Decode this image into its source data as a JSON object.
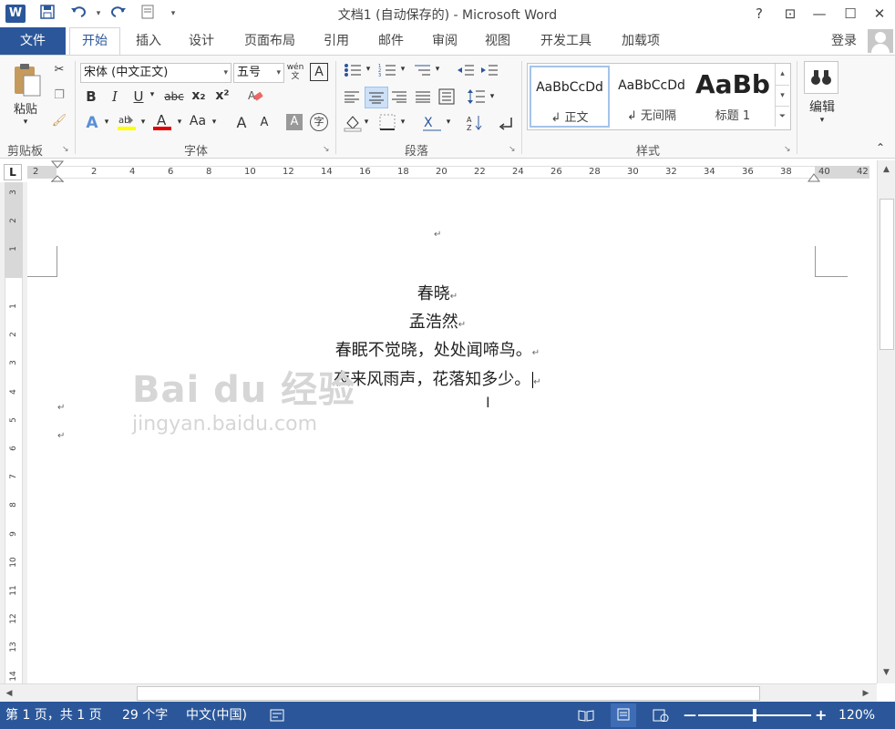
{
  "app": {
    "title": "文档1 (自动保存的) - Microsoft Word",
    "logo_letter": "W",
    "brand_color": "#2b579a"
  },
  "qat": {
    "save_icon": "save-icon",
    "undo_icon": "undo-icon",
    "redo_icon": "redo-icon",
    "customize_icon": "customize-qat-icon"
  },
  "window_buttons": {
    "help": "?",
    "restore_ribbon": "⊡",
    "minimize": "—",
    "maximize": "☐",
    "close": "✕"
  },
  "tabs": {
    "file": "文件",
    "items": [
      "开始",
      "插入",
      "设计",
      "页面布局",
      "引用",
      "邮件",
      "审阅",
      "视图",
      "开发工具",
      "加载项"
    ],
    "active": "开始",
    "login": "登录"
  },
  "ribbon": {
    "clipboard": {
      "label": "剪贴板",
      "paste": "粘贴"
    },
    "font": {
      "label": "字体",
      "font_name": "宋体 (中文正文)",
      "font_size": "五号",
      "wen": "wén\n文",
      "bold": "B",
      "italic": "I",
      "underline": "U",
      "strike": "abc",
      "sub": "x₂",
      "sup": "x²",
      "aa": "Aa",
      "grow": "A",
      "shrink": "A"
    },
    "paragraph": {
      "label": "段落"
    },
    "styles": {
      "label": "样式",
      "items": [
        {
          "sample": "AaBbCcDd",
          "name": "↲ 正文"
        },
        {
          "sample": "AaBbCcDd",
          "name": "↲ 无间隔"
        },
        {
          "sample": "AaBb",
          "name": "标题 1"
        }
      ]
    },
    "editing": {
      "label": "编辑"
    }
  },
  "ruler": {
    "corner": "L",
    "ticks": [
      "2",
      "2",
      "4",
      "6",
      "8",
      "10",
      "12",
      "14",
      "16",
      "18",
      "20",
      "22",
      "24",
      "26",
      "28",
      "30",
      "32",
      "34",
      "36",
      "38",
      "40",
      "42"
    ],
    "vticks": [
      "3",
      "2",
      "1",
      "1",
      "2",
      "3",
      "4",
      "5",
      "6",
      "7",
      "8",
      "9",
      "10",
      "11",
      "12",
      "13",
      "14"
    ]
  },
  "document": {
    "lines": [
      "春晓",
      "孟浩然",
      "春眠不觉晓，处处闻啼鸟。",
      "夜来风雨声，花落知多少。"
    ],
    "para_mark": "↵",
    "watermark_top": "Bai du 经验",
    "watermark_bottom": "jingyan.baidu.com"
  },
  "status": {
    "page": "第 1 页，共 1 页",
    "words": "29 个字",
    "language": "中文(中国)",
    "zoom": "120%",
    "zoom_minus": "—",
    "zoom_plus": "+"
  }
}
